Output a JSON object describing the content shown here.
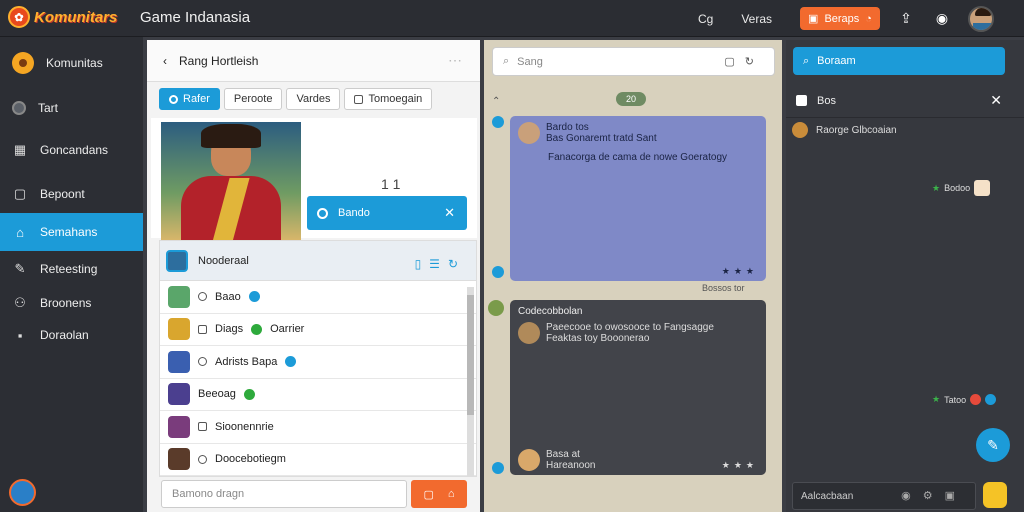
{
  "topbar": {
    "logo_text": "Komunitars",
    "app_title": "Game Indanasia",
    "link1": "Cg",
    "link2": "Veras",
    "action_btn": "Beraps"
  },
  "sidebar": {
    "items": [
      {
        "label": "Komunitas"
      },
      {
        "label": "Tart"
      },
      {
        "label": "Goncandans"
      },
      {
        "label": "Bepoont"
      },
      {
        "label": "Semahans"
      },
      {
        "label": "Reteesting"
      },
      {
        "label": "Broonens"
      },
      {
        "label": "Doraolan"
      }
    ]
  },
  "panel1": {
    "title": "Rang Hortleish",
    "tabs": [
      "Rafer",
      "Peroote",
      "Vardes",
      "Tomoegain"
    ],
    "feature_count": "1 1",
    "feature_btn": "Bando",
    "list_head": "Nooderaal",
    "rows": [
      "Baao",
      "Diags",
      "Adrists Bapa",
      "Beeoag",
      "Sioonennrie",
      "Doocebotiegm"
    ],
    "row_badges": [
      "",
      "Oarrier",
      "",
      "",
      "",
      ""
    ],
    "compose_placeholder": "Bamono dragn"
  },
  "panel2": {
    "search_placeholder": "Sang",
    "day": "20",
    "msg1_name": "Bardo tos",
    "msg1_line1": "Bas Gonaremt tratd Sant",
    "msg1_line2": "Fanacorga de cama de nowe Goeratogy",
    "msg1_under": "Bossos tor",
    "msg2_title": "Codecobbolan",
    "msg2_line1": "Paeecooe to owosooce to Fangsagge",
    "msg2_line2": "Feaktas toy Booonerao",
    "msg2_name": "Basa at",
    "msg2_sub": "Hareanoon"
  },
  "panel3": {
    "search_btn": "Boraam",
    "head": "Bos",
    "item1": "Raorge Glbcoaian",
    "tag1": "Bodoo",
    "tag2": "Tatoo",
    "compose": "Aalcacbaan"
  }
}
